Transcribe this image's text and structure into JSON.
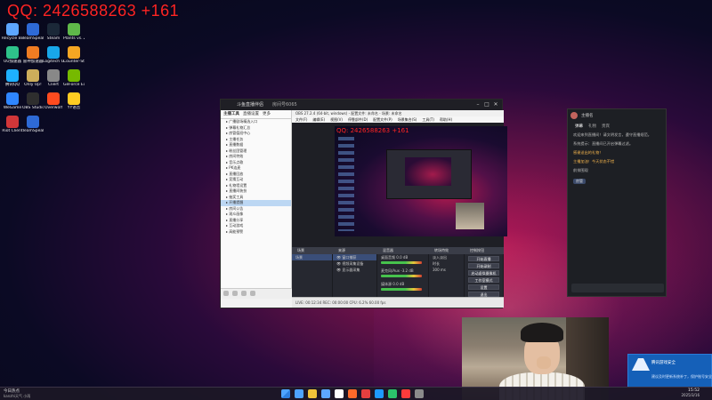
{
  "overlay_id": "QQ: 2426588263 +161",
  "desktop_icons": [
    {
      "label": "Recycle Bin",
      "color": "#5da7ff"
    },
    {
      "label": "TeamSpeak Overlay",
      "color": "#2e6ad6"
    },
    {
      "label": "Steam",
      "color": "#1b2838"
    },
    {
      "label": "Plants vs. Zombies",
      "color": "#5fb84a"
    },
    {
      "label": "UU加速器",
      "color": "#2ec28a"
    },
    {
      "label": "雷神加速器",
      "color": "#ef7c22"
    },
    {
      "label": "Logitech G HUB",
      "color": "#18a7e8"
    },
    {
      "label": "Counter-Strike 2",
      "color": "#f5a623"
    },
    {
      "label": "腾讯QQ",
      "color": "#1eb0ff"
    },
    {
      "label": "Only Up!",
      "color": "#ccae5b"
    },
    {
      "label": "Cliert",
      "color": "#888888"
    },
    {
      "label": "GeForce Experience",
      "color": "#76b900"
    },
    {
      "label": "WeGame",
      "color": "#2f86ff"
    },
    {
      "label": "OBS Studio",
      "color": "#2e2e2e"
    },
    {
      "label": "Overwolf",
      "color": "#ff4b1f"
    },
    {
      "label": "YY语音",
      "color": "#ffcc22"
    },
    {
      "label": "Riot Client",
      "color": "#d13639"
    },
    {
      "label": "TeamSpeak 3 Client",
      "color": "#2e6ad6"
    }
  ],
  "main_window": {
    "title": "斗鱼直播伴侣",
    "room": "房间号6065",
    "tabs": [
      "主播工具",
      "直播设置",
      "更多"
    ],
    "list_items": [
      "广播剧场精选入口",
      "弹幕礼物汇总",
      "房管值班中心",
      "主播任务",
      "直播数据",
      "粉丝团管理",
      "房间特效",
      "音乐点歌",
      "PK连麦",
      "直播回放",
      "竞猜互动",
      "礼物墙设置",
      "直播间装扮",
      "抽奖工具",
      "开播提醒",
      "房间公告",
      "观众画像",
      "直播分享",
      "互动游戏",
      "高能预警"
    ],
    "obs_title": "OBS 27.2.4 (64-bit, windows) - 配置文件: 未命名 - 场景: 未命名",
    "obs_menu": [
      "文件(F)",
      "编辑(E)",
      "视图(V)",
      "停靠部件(D)",
      "配置文件(P)",
      "场景集合(S)",
      "工具(T)",
      "帮助(H)"
    ],
    "preview_overlay": "QQ: 2426588263 +161",
    "dock_headers": [
      "场景",
      "来源",
      "混音器",
      "转场特效",
      "控制按钮"
    ],
    "scene_label": "场景",
    "sources": [
      "窗口捕获",
      "视频采集设备",
      "显示器采集"
    ],
    "mixer": [
      {
        "name": "桌面音频",
        "db": "0.0 dB"
      },
      {
        "name": "麦克风/Aux",
        "db": "-3.2 dB"
      },
      {
        "name": "媒体源",
        "db": "0.0 dB"
      }
    ],
    "transition": {
      "name": "淡入淡出",
      "duration_label": "时长",
      "duration": "300 ms"
    },
    "controls": [
      "开始直播",
      "开始录制",
      "启动虚拟摄像机",
      "工作室模式",
      "设置",
      "退出"
    ],
    "status": "LIVE: 00:12:34  REC: 00:00:00  CPU: 6.2%  60.00 fps"
  },
  "chat": {
    "streamer": "主播名",
    "tabs": [
      "弹幕",
      "礼物",
      "贵宾"
    ],
    "messages": [
      {
        "text": "欢迎来到直播间！请文明发言，遵守直播规范。",
        "hl": false
      },
      {
        "text": "系统提示：直播间已开启弹幕过滤。",
        "hl": false
      },
      {
        "text": "感谢送出的礼物！",
        "hl": true
      },
      {
        "text": "主播加油！今天状态不错",
        "hl": true
      },
      {
        "text": "前排围观",
        "hl": false
      }
    ],
    "badge": "房管"
  },
  "notification": {
    "title": "腾讯游戏安全",
    "subtitle": "建议及时更新系统补丁，保护账号安全"
  },
  "taskbar": {
    "news_line1": "今日热点",
    "news_line2": "kanzhi天气 小雨",
    "time": "15:52",
    "date": "2025/3/16",
    "apps": [
      "#4ea3ff",
      "#f0c43a",
      "#5da7ff",
      "#ffffff",
      "#ff6a2a",
      "#e43f3f",
      "#1e9bff",
      "#2bc36b",
      "#ff3b3b",
      "#8b8b8b"
    ]
  }
}
